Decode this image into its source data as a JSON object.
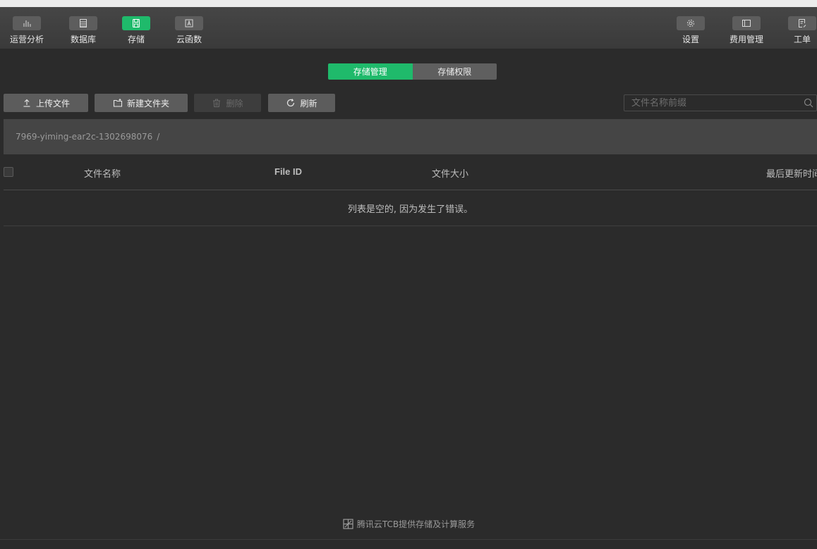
{
  "toolbar": {
    "left": [
      {
        "label": "运营分析",
        "icon": "chart-icon"
      },
      {
        "label": "数据库",
        "icon": "database-icon"
      },
      {
        "label": "存储",
        "icon": "storage-icon",
        "active": true
      },
      {
        "label": "云函数",
        "icon": "function-icon"
      }
    ],
    "right": [
      {
        "label": "设置",
        "icon": "gear-icon"
      },
      {
        "label": "费用管理",
        "icon": "billing-icon"
      },
      {
        "label": "工单",
        "icon": "ticket-icon"
      }
    ]
  },
  "tabs": [
    {
      "label": "存储管理",
      "active": true
    },
    {
      "label": "存储权限",
      "active": false
    }
  ],
  "actions": {
    "upload": "上传文件",
    "new_folder": "新建文件夹",
    "delete": "删除",
    "refresh": "刷新"
  },
  "search": {
    "placeholder": "文件名称前缀",
    "value": ""
  },
  "breadcrumb": {
    "bucket": "7969-yiming-ear2c-1302698076",
    "separator": "/"
  },
  "table": {
    "columns": [
      "文件名称",
      "File ID",
      "文件大小",
      "最后更新时间"
    ],
    "empty_message": "列表是空的, 因为发生了错误。"
  },
  "footer": {
    "text": "腾讯云TCB提供存储及计算服务"
  },
  "colors": {
    "accent": "#1fba6b",
    "background": "#2b2b2b",
    "toolbar": "#404040"
  }
}
